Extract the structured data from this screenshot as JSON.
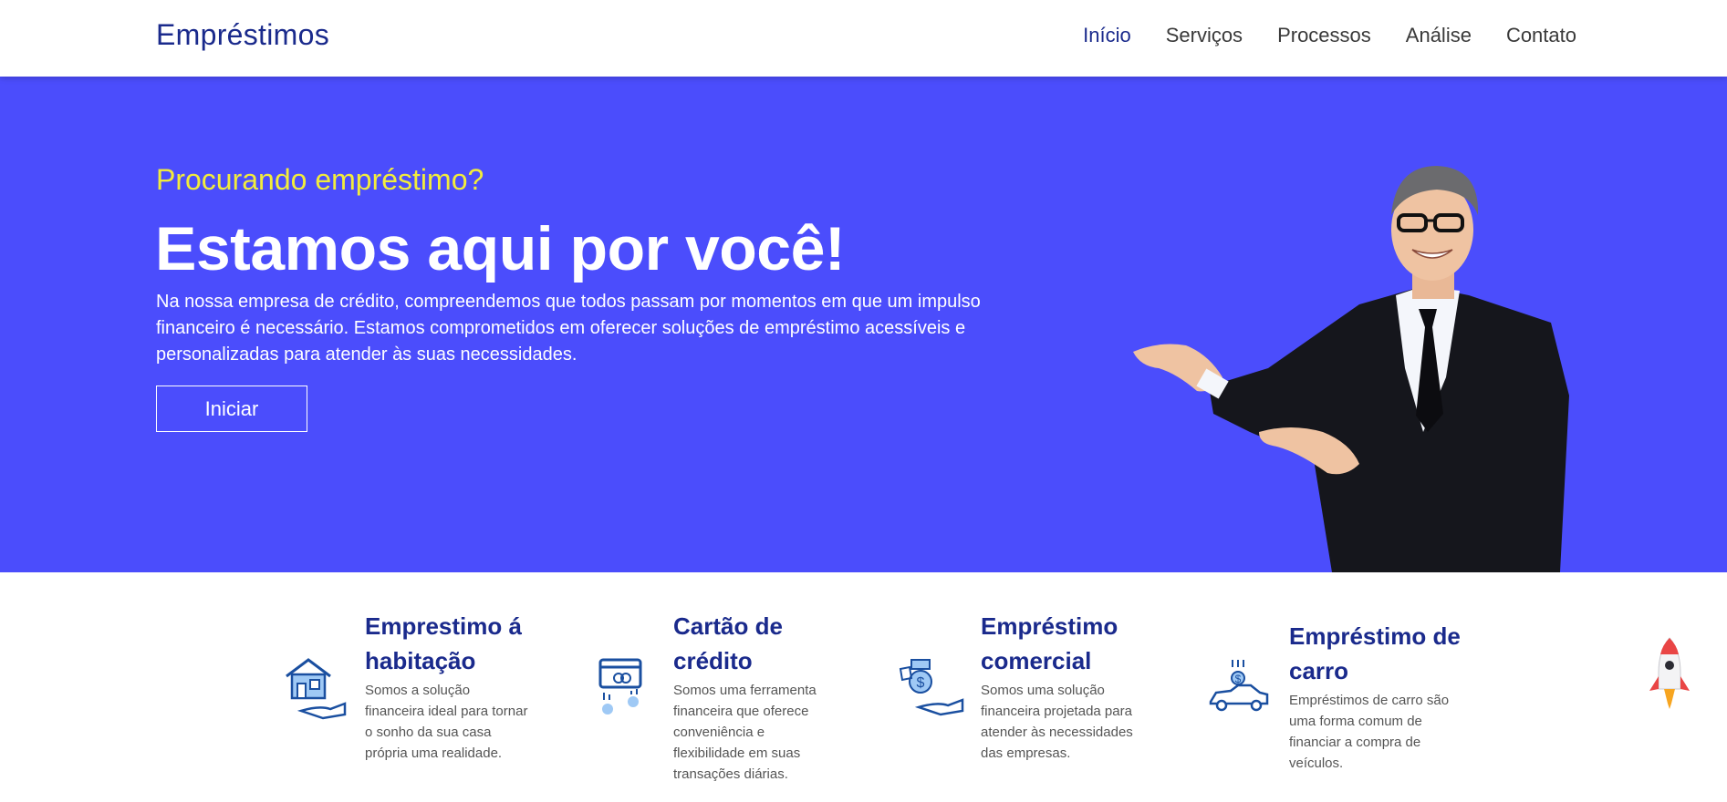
{
  "header": {
    "brand": "Empréstimos",
    "nav": [
      "Início",
      "Serviços",
      "Processos",
      "Análise",
      "Contato"
    ]
  },
  "hero": {
    "subtitle": "Procurando empréstimo?",
    "title": "Estamos aqui por você!",
    "text": "Na nossa empresa de crédito, compreendemos que todos passam por momentos em que um impulso financeiro é necessário. Estamos comprometidos em oferecer soluções de empréstimo acessíveis e personalizadas para atender às suas necessidades.",
    "button": "Iniciar"
  },
  "services": [
    {
      "title": "Emprestimo á habitação",
      "desc": "Somos a solução financeira ideal para tornar o sonho da sua casa própria uma realidade.",
      "icon": "house-hand-icon"
    },
    {
      "title": "Cartão de crédito",
      "desc": "Somos uma ferramenta financeira que oferece conveniência e flexibilidade em suas transações diárias.",
      "icon": "credit-card-icon"
    },
    {
      "title": "Empréstimo comercial",
      "desc": "Somos uma solução financeira projetada para atender às necessidades das empresas.",
      "icon": "money-hand-icon"
    },
    {
      "title": "Empréstimo de carro",
      "desc": "Empréstimos de carro são uma forma comum de financiar a compra de veículos.",
      "icon": "car-money-icon"
    }
  ],
  "colors": {
    "hero_bg": "#4b4dfc",
    "brand": "#1a2a8c",
    "accent_yellow": "#f2ec3c"
  }
}
